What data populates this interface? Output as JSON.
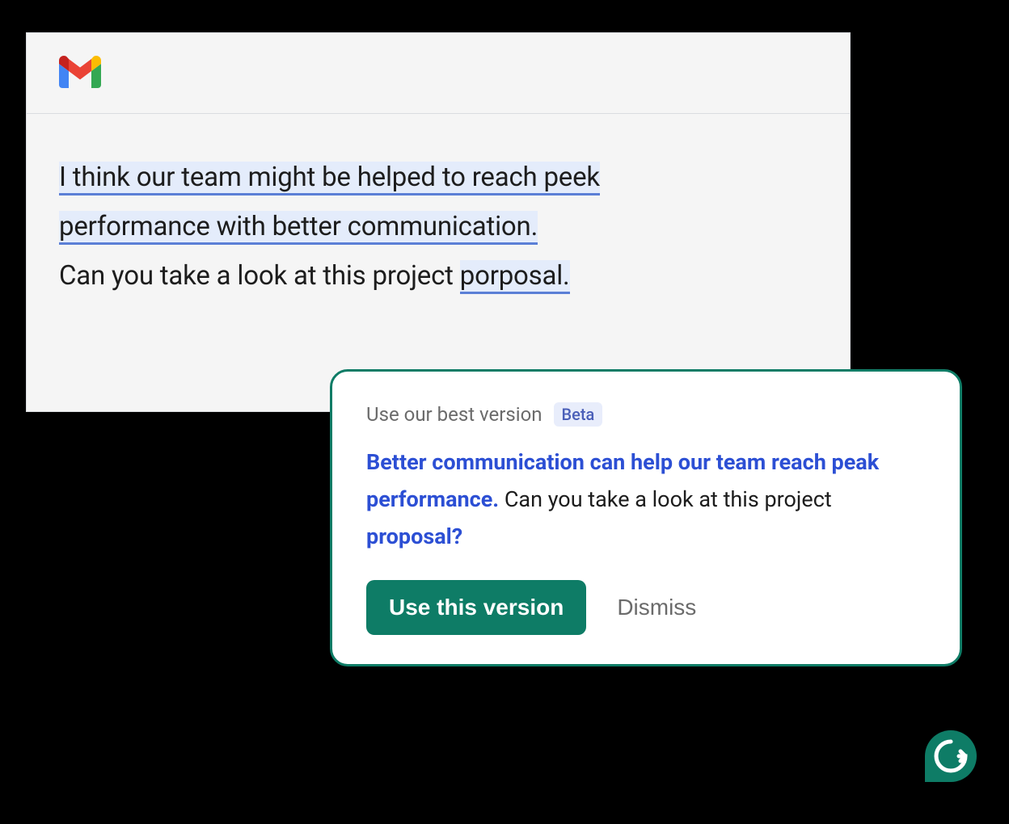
{
  "email": {
    "highlighted_sentence_1": "I think our team might be helped to reach peek",
    "highlighted_sentence_2": "performance with better communication.",
    "plain_prefix": "Can you take a look at this project ",
    "highlighted_word": "porposal."
  },
  "popup": {
    "header_label": "Use our best version",
    "badge": "Beta",
    "suggestion_part1": "Better communication can help our team reach peak performance.",
    "suggestion_plain_mid": " Can you take a look at this project ",
    "suggestion_part2": "proposal?",
    "primary_button": "Use this version",
    "dismiss_button": "Dismiss"
  },
  "icons": {
    "gmail": "gmail-icon",
    "grammarly": "grammarly-icon"
  }
}
